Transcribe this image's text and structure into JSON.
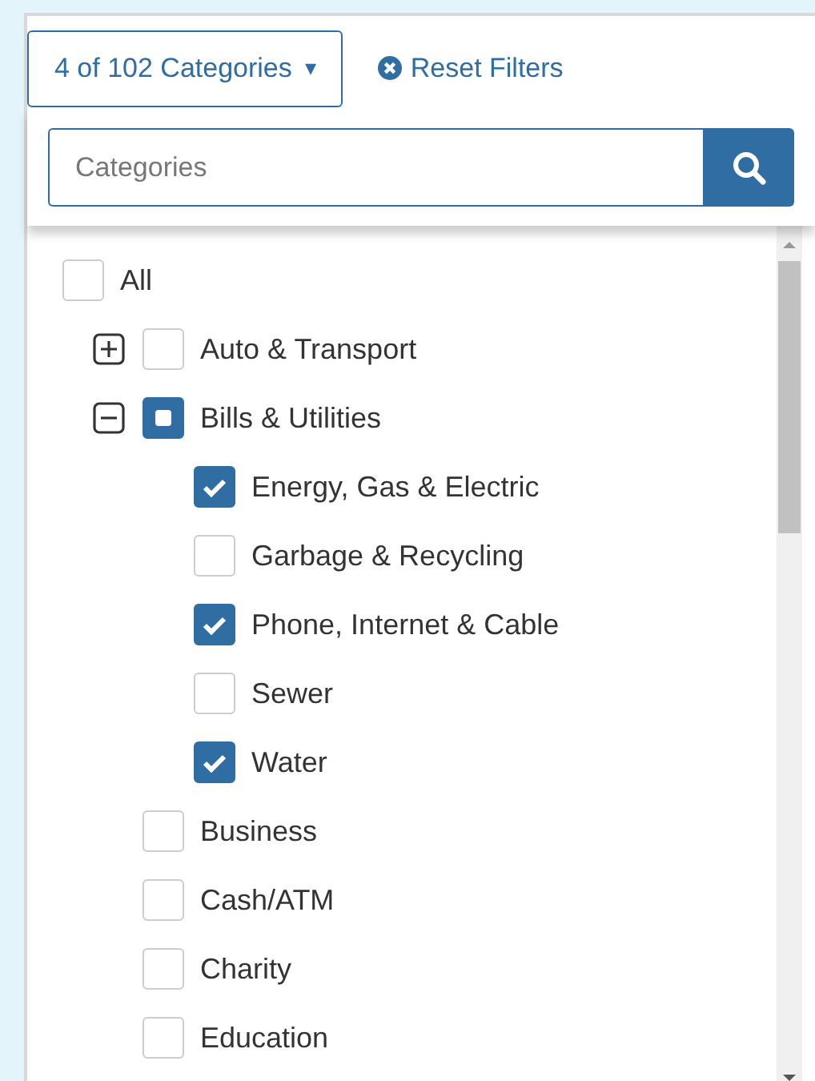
{
  "filter_button": {
    "label": "4 of 102 Categories",
    "caret": "▾"
  },
  "reset_link": {
    "label": "Reset Filters"
  },
  "search": {
    "placeholder": "Categories"
  },
  "tree": [
    {
      "label": "All",
      "checked": false,
      "children": [
        {
          "label": "Auto & Transport",
          "checked": false,
          "expanded": false
        },
        {
          "label": "Bills & Utilities",
          "checked": true,
          "partial": true,
          "expanded": true,
          "children": [
            {
              "label": "Energy, Gas & Electric",
              "checked": true
            },
            {
              "label": "Garbage & Recycling",
              "checked": false
            },
            {
              "label": "Phone, Internet & Cable",
              "checked": true
            },
            {
              "label": "Sewer",
              "checked": false
            },
            {
              "label": "Water",
              "checked": true
            }
          ]
        },
        {
          "label": "Business",
          "checked": false
        },
        {
          "label": "Cash/ATM",
          "checked": false
        },
        {
          "label": "Charity",
          "checked": false
        },
        {
          "label": "Education",
          "checked": false
        }
      ]
    }
  ]
}
